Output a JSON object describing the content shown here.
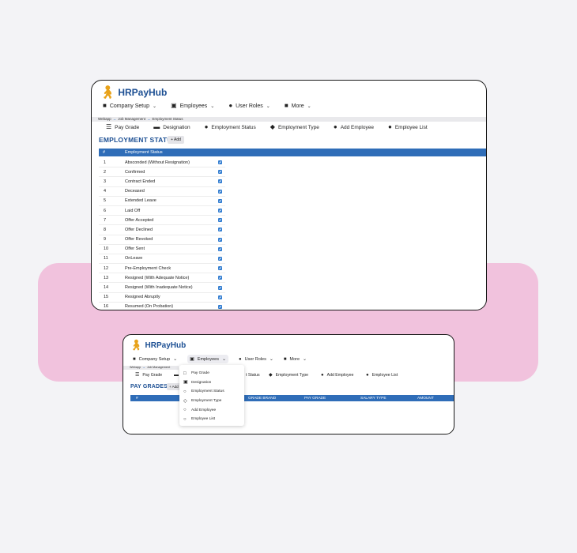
{
  "app": {
    "name": "HRPayHub",
    "brand_color": "#1c4f93",
    "accent_color": "#e8a21a",
    "pink": "#f1c2dd"
  },
  "nav": {
    "items": [
      {
        "label": "Company Setup",
        "icon": "building-icon"
      },
      {
        "label": "Employees",
        "icon": "badge-icon"
      },
      {
        "label": "User Roles",
        "icon": "user-icon"
      },
      {
        "label": "More",
        "icon": "book-icon"
      }
    ]
  },
  "breadcrumb": {
    "home": "Webapp",
    "middle": "Job Management",
    "current": "Employment Status"
  },
  "breadcrumb2": {
    "home": "Webapp",
    "middle": "Job Management"
  },
  "subnav": {
    "items": [
      "Pay Grade",
      "Designation",
      "Employment Status",
      "Employment Type",
      "Add Employee",
      "Employee List"
    ]
  },
  "subnav2": {
    "items": [
      "Pay Grade",
      "t Status",
      "Employment Type",
      "Add Employee",
      "Employee List"
    ]
  },
  "screen1": {
    "title": "EMPLOYMENT STATUS",
    "add_label": "+ Add",
    "columns": [
      "#",
      "Employment Status"
    ],
    "rows": [
      {
        "num": "1",
        "name": "Absconded (Without Resignation)"
      },
      {
        "num": "2",
        "name": "Confirmed"
      },
      {
        "num": "3",
        "name": "Contract Ended"
      },
      {
        "num": "4",
        "name": "Deceased"
      },
      {
        "num": "5",
        "name": "Extended Leave"
      },
      {
        "num": "6",
        "name": "Laid Off"
      },
      {
        "num": "7",
        "name": "Offer Accepted"
      },
      {
        "num": "8",
        "name": "Offer Declined"
      },
      {
        "num": "9",
        "name": "Offer Revoked"
      },
      {
        "num": "10",
        "name": "Offer Sent"
      },
      {
        "num": "11",
        "name": "OnLeave"
      },
      {
        "num": "12",
        "name": "Pre-Employment Check"
      },
      {
        "num": "13",
        "name": "Resigned (With Adequate Notice)"
      },
      {
        "num": "14",
        "name": "Resigned (With Inadequate Notice)"
      },
      {
        "num": "15",
        "name": "Resigned Abruptly"
      },
      {
        "num": "16",
        "name": "Resumed (On Probation)"
      }
    ]
  },
  "screen2": {
    "title": "PAY GRADES",
    "add_label": "+ Add",
    "columns": [
      "#",
      "GRADE BRAND",
      "PAY GRADE",
      "SALARY TYPE",
      "AMOUNT"
    ],
    "dropdown": [
      {
        "label": "Pay Grade",
        "icon": "calendar-icon"
      },
      {
        "label": "Designation",
        "icon": "id-card-icon"
      },
      {
        "label": "Employment Status",
        "icon": "info-icon"
      },
      {
        "label": "Employment Type",
        "icon": "tag-icon"
      },
      {
        "label": "Add Employee",
        "icon": "user-add-icon"
      },
      {
        "label": "Employee List",
        "icon": "users-icon"
      }
    ]
  }
}
